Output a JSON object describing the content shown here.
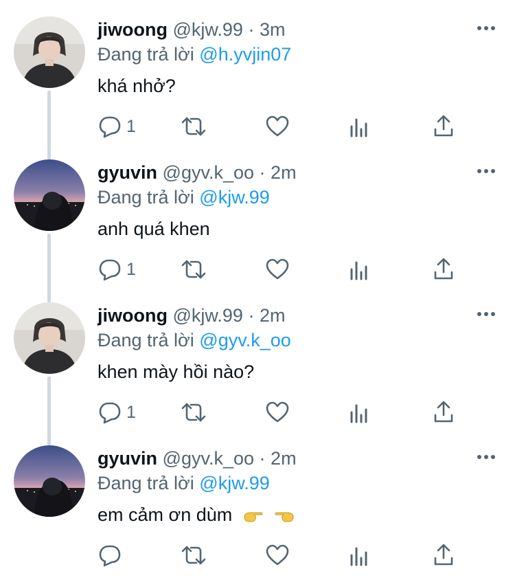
{
  "tweets": [
    {
      "name": "jiwoong",
      "handle": "@kjw.99",
      "sep": "·",
      "time": "3m",
      "reply_prefix": "Đang trả lời",
      "reply_to": "@h.yvjin07",
      "text": "khá nhở?",
      "reply_count": "1",
      "avatar_icon": "person-portrait-avatar"
    },
    {
      "name": "gyuvin",
      "handle": "@gyv.k_oo",
      "sep": "·",
      "time": "2m",
      "reply_prefix": "Đang trả lời",
      "reply_to": "@kjw.99",
      "text": "anh quá khen",
      "reply_count": "1",
      "avatar_icon": "night-sky-avatar"
    },
    {
      "name": "jiwoong",
      "handle": "@kjw.99",
      "sep": "·",
      "time": "2m",
      "reply_prefix": "Đang trả lời",
      "reply_to": "@gyv.k_oo",
      "text": "khen mày hồi nào?",
      "reply_count": "1",
      "avatar_icon": "person-portrait-avatar"
    },
    {
      "name": "gyuvin",
      "handle": "@gyv.k_oo",
      "sep": "·",
      "time": "2m",
      "reply_prefix": "Đang trả lời",
      "reply_to": "@kjw.99",
      "text": "em cảm ơn dùm",
      "reply_count": "",
      "avatar_icon": "night-sky-avatar"
    }
  ],
  "icons": [
    "reply-icon",
    "retweet-icon",
    "like-icon",
    "analytics-icon",
    "share-icon",
    "more-icon",
    "pointing-hand-icon"
  ],
  "colors": {
    "text": "#0f1419",
    "muted": "#536471",
    "link": "#1d9bf0",
    "thread": "#cfd9de"
  }
}
